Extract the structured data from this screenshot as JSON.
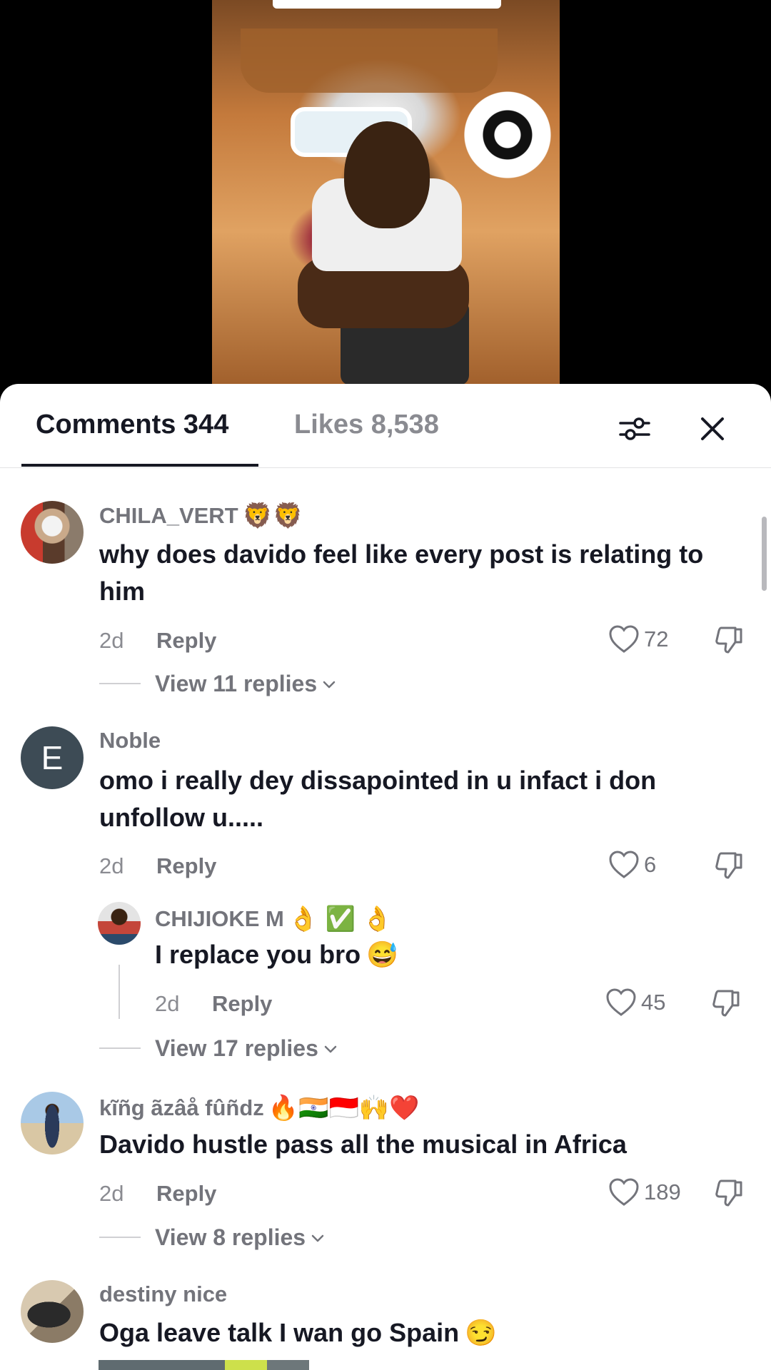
{
  "tabs": {
    "comments_label": "Comments 344",
    "likes_label": "Likes 8,538"
  },
  "icons": {
    "filter": "sliders-icon",
    "close": "close-icon",
    "heart": "heart-outline-icon",
    "dislike": "thumbs-down-icon",
    "chevron": "chevron-down-icon"
  },
  "comments": [
    {
      "username": "CHILA_VERT",
      "badge": "🦁🦁",
      "text": "why does davido feel like every post is relating to him",
      "time": "2d",
      "reply_label": "Reply",
      "likes": "72",
      "view_replies": "View 11 replies"
    },
    {
      "username": "Noble",
      "avatar_letter": "E",
      "text": "omo i really dey dissapointed in u infact i don unfollow u.....",
      "time": "2d",
      "reply_label": "Reply",
      "likes": "6",
      "reply": {
        "username": "CHIJIOKE M",
        "badge": "👌 ✅ 👌",
        "text": "I replace you bro",
        "emoji": "😅",
        "time": "2d",
        "reply_label": "Reply",
        "likes": "45"
      },
      "view_replies": "View 17 replies"
    },
    {
      "username": "kĩñg ãzâå fûñdz",
      "badge": "🔥🇮🇳🇮🇩🙌❤️",
      "text": "Davido hustle pass all the musical in Africa",
      "time": "2d",
      "reply_label": "Reply",
      "likes": "189",
      "view_replies": "View 8 replies"
    },
    {
      "username": "destiny nice",
      "text": "Oga leave talk I wan go Spain",
      "emoji": "😏"
    }
  ],
  "colors": {
    "primary_text": "#161823",
    "secondary_text": "#73747b",
    "avatar_noble": "#3d4b55"
  }
}
